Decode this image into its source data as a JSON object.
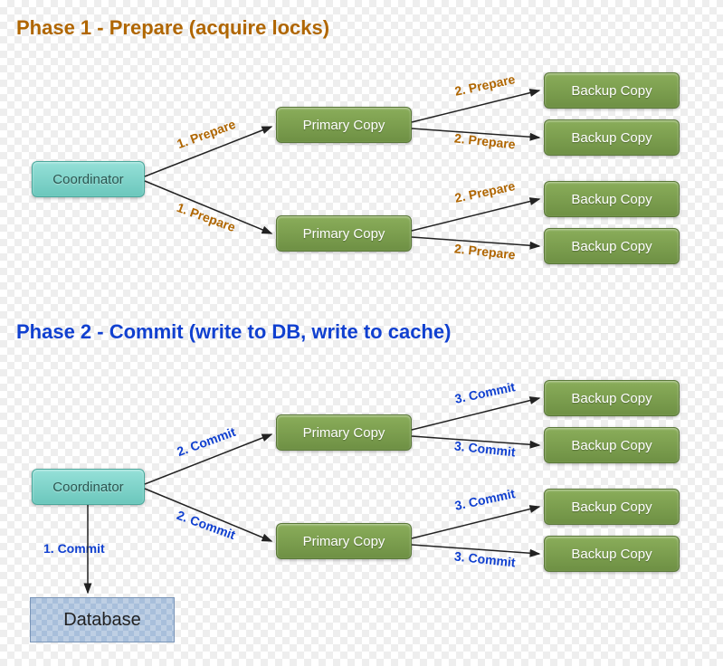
{
  "phase1": {
    "title": "Phase 1 - Prepare (acquire locks)",
    "coordinator": "Coordinator",
    "primary": "Primary Copy",
    "backup": "Backup Copy",
    "edge_coord_primary": "1. Prepare",
    "edge_primary_backup": "2. Prepare"
  },
  "phase2": {
    "title": "Phase 2 - Commit (write to DB, write to cache)",
    "coordinator": "Coordinator",
    "primary": "Primary Copy",
    "backup": "Backup Copy",
    "database": "Database",
    "edge_coord_db": "1. Commit",
    "edge_coord_primary": "2. Commit",
    "edge_primary_backup": "3. Commit"
  }
}
